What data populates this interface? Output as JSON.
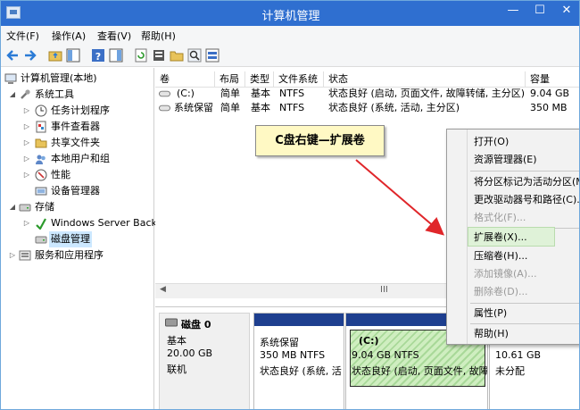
{
  "window": {
    "title": "计算机管理"
  },
  "menubar": [
    "文件(F)",
    "操作(A)",
    "查看(V)",
    "帮助(H)"
  ],
  "tree": {
    "root": "计算机管理(本地)",
    "system_tools": "系统工具",
    "task_scheduler": "任务计划程序",
    "event_viewer": "事件查看器",
    "shared_folders": "共享文件夹",
    "local_users": "本地用户和组",
    "performance": "性能",
    "device_manager": "设备管理器",
    "storage": "存储",
    "windows_server_backup": "Windows Server Back",
    "disk_management": "磁盘管理",
    "services_apps": "服务和应用程序"
  },
  "volumes": {
    "columns": [
      "卷",
      "布局",
      "类型",
      "文件系统",
      "状态",
      "容量"
    ],
    "rows": [
      [
        "(C:)",
        "简单",
        "基本",
        "NTFS",
        "状态良好 (启动, 页面文件, 故障转储, 主分区)",
        "9.04 GB"
      ],
      [
        "系统保留",
        "简单",
        "基本",
        "NTFS",
        "状态良好 (系统, 活动, 主分区)",
        "350 MB"
      ]
    ]
  },
  "scrollbar_grip": "III",
  "disk": {
    "name": "磁盘 0",
    "type": "基本",
    "size": "20.00 GB",
    "status": "联机",
    "partitions": [
      {
        "name": "系统保留",
        "size": "350 MB NTFS",
        "status": "状态良好 (系统, 活"
      },
      {
        "name": "(C:)",
        "size": "9.04 GB NTFS",
        "status": "状态良好 (启动, 页面文件, 故障"
      },
      {
        "name": "",
        "size": "10.61 GB",
        "status": "未分配"
      }
    ]
  },
  "callout": "C盘右键—扩展卷",
  "context_menu": {
    "open": "打开(O)",
    "explorer": "资源管理器(E)",
    "mark_active": "将分区标记为活动分区(M)",
    "change_letter": "更改驱动器号和路径(C)...",
    "format": "格式化(F)...",
    "extend": "扩展卷(X)...",
    "shrink": "压缩卷(H)...",
    "add_mirror": "添加镜像(A)...",
    "delete": "删除卷(D)...",
    "properties": "属性(P)",
    "help": "帮助(H)"
  },
  "colors": {
    "titlebar": "#2f6fd0",
    "partition_header": "#1e3f8f",
    "callout_bg": "#fff9c4",
    "menu_highlight": "#dff2d8",
    "arrow": "#e0262a"
  }
}
